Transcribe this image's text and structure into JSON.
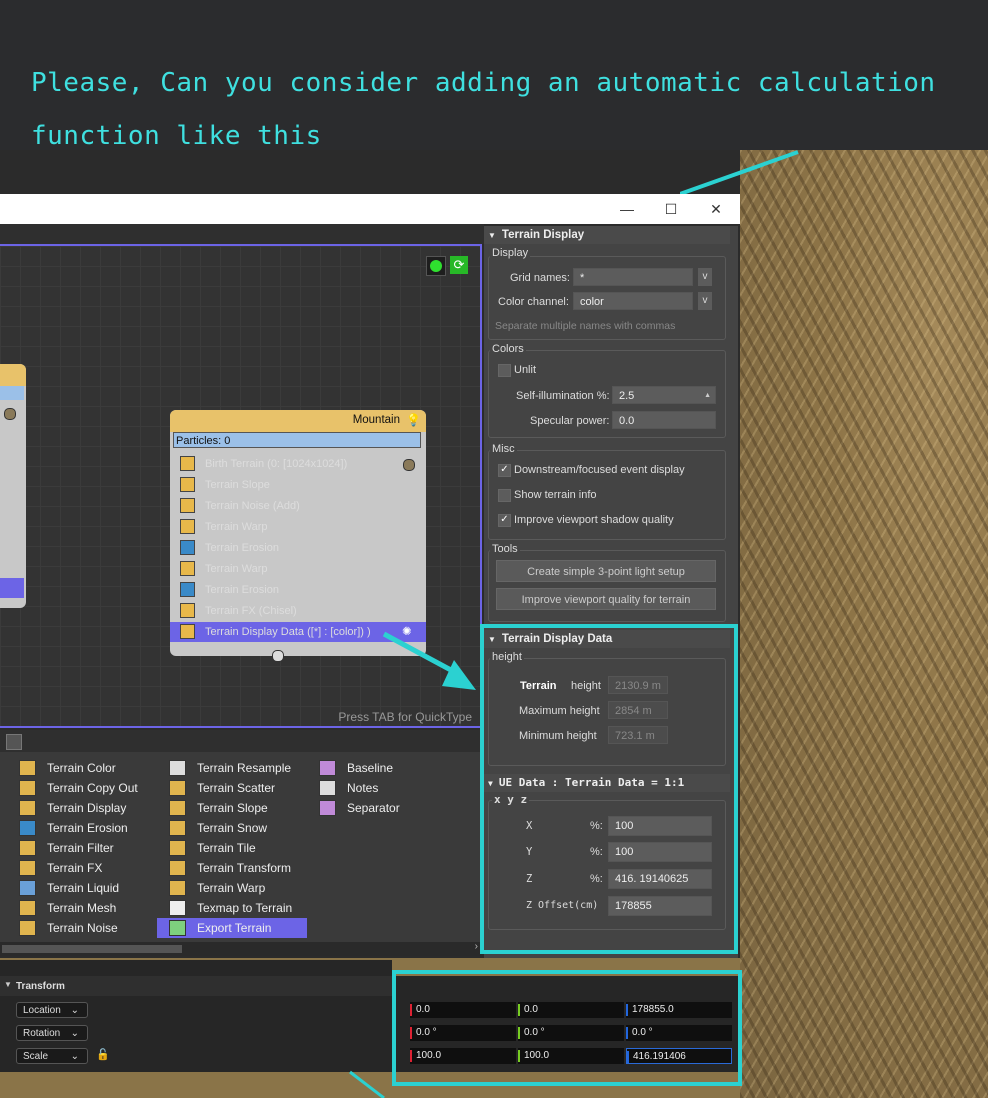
{
  "banner": {
    "line1": "Please, Can you consider adding an automatic calculation",
    "line2": "function like this"
  },
  "window": {
    "minimize": "—",
    "maximize": "☐",
    "close": "✕"
  },
  "graph": {
    "hint": "Press TAB for QuickType",
    "node": {
      "title": "Mountain",
      "particles": "Particles: 0",
      "items": [
        "Birth Terrain (0: [1024x1024])",
        "Terrain Slope",
        "Terrain Noise (Add)",
        "Terrain Warp",
        "Terrain Erosion",
        "Terrain Warp",
        "Terrain Erosion",
        "Terrain FX (Chisel)",
        "Terrain Display  Data ([*] : [color])  )"
      ]
    }
  },
  "panel": {
    "terrain_display": {
      "title": "Terrain Display",
      "display_group": "Display",
      "grid_names_label": "Grid names:",
      "grid_names_value": "*",
      "color_channel_label": "Color channel:",
      "color_channel_value": "color",
      "v": "v",
      "hint": "Separate multiple names with commas",
      "colors_group": "Colors",
      "unlit": "Unlit",
      "self_illum_label": "Self-illumination %:",
      "self_illum_value": "2.5",
      "specular_label": "Specular power:",
      "specular_value": "0.0",
      "misc_group": "Misc",
      "misc1": "Downstream/focused event display",
      "misc2": "Show terrain info",
      "misc3": "Improve viewport shadow quality",
      "tools_group": "Tools",
      "tool1": "Create simple 3-point light setup",
      "tool2": "Improve viewport quality for terrain"
    },
    "terrain_display_data": {
      "title": "Terrain Display Data",
      "group": "height",
      "terrain_label": "Terrain",
      "height_label": "height",
      "height_value": "2130.9 m",
      "max_label": "Maximum height",
      "max_value": "2854   m",
      "min_label": "Minimum height",
      "min_value": "723.1   m"
    },
    "ue_data": {
      "title": "UE Data : Terrain Data = 1:1",
      "group": "x y z",
      "rows": [
        {
          "axis": "X",
          "unit": "%:",
          "value": "100"
        },
        {
          "axis": "Y",
          "unit": "%:",
          "value": "100"
        },
        {
          "axis": "Z",
          "unit": "%:",
          "value": "416. 19140625"
        },
        {
          "axis": "Z Offset(cm)",
          "unit": "",
          "value": "178855"
        }
      ]
    }
  },
  "palette": {
    "col1": [
      "Terrain Color",
      "Terrain Copy Out",
      "Terrain Display",
      "Terrain Erosion",
      "Terrain Filter",
      "Terrain FX",
      "Terrain Liquid",
      "Terrain Mesh",
      "Terrain Noise"
    ],
    "col2": [
      "Terrain Resample",
      "Terrain Scatter",
      "Terrain Slope",
      "Terrain Snow",
      "Terrain Tile",
      "Terrain Transform",
      "Terrain Warp",
      "Texmap to Terrain",
      "Export Terrain"
    ],
    "col3": [
      "Baseline",
      "Notes",
      "Separator"
    ]
  },
  "transform": {
    "title": "Transform",
    "location": "Location",
    "rotation": "Rotation",
    "scale": "Scale",
    "loc_values": [
      "0.0",
      "0.0",
      "178855.0"
    ],
    "rot_values": [
      "0.0 °",
      "0.0 °",
      "0.0 °"
    ],
    "scale_values": [
      "100.0",
      "100.0",
      "416.191406"
    ]
  },
  "colors": {
    "accent_teal": "#2bd1d1",
    "node_select": "#6c64e6"
  }
}
